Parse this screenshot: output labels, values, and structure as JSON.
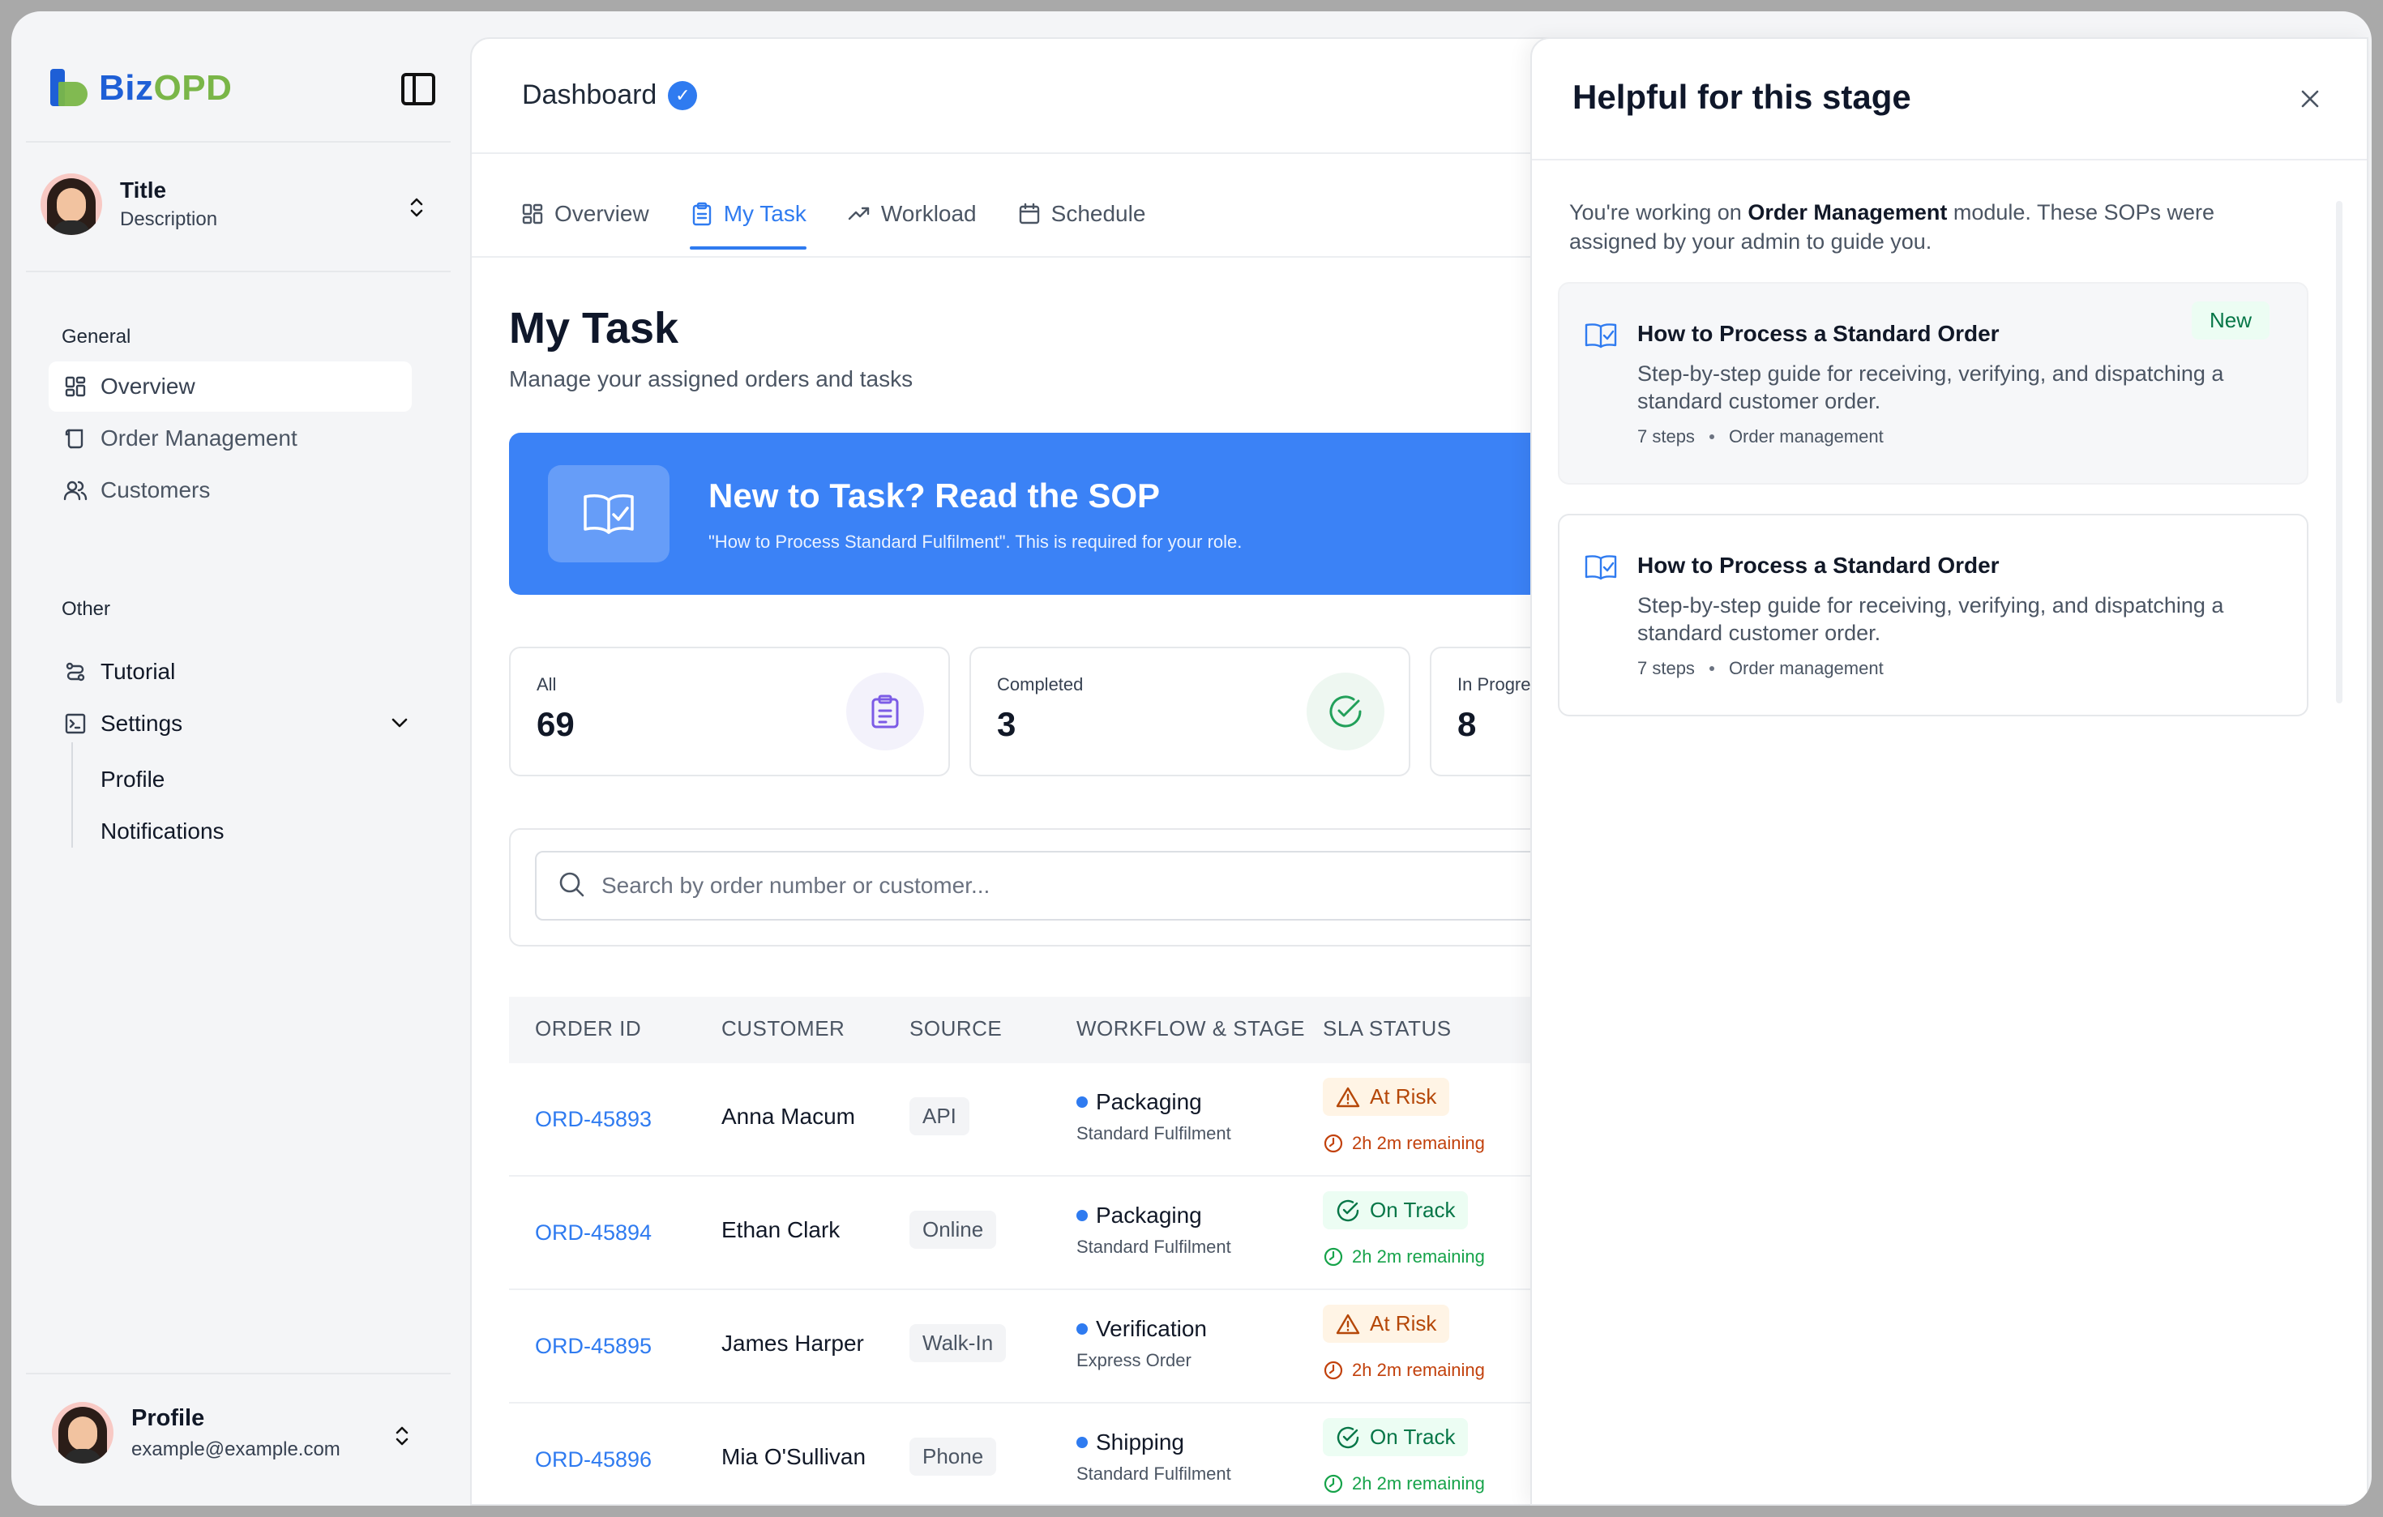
{
  "app": {
    "logo_left": "Biz",
    "logo_right": "OPD"
  },
  "sidebar": {
    "user_top": {
      "title": "Title",
      "description": "Description"
    },
    "general_label": "General",
    "general_items": [
      {
        "label": "Overview",
        "icon": "grid-icon",
        "active": true
      },
      {
        "label": "Order Management",
        "icon": "scroll-icon"
      },
      {
        "label": "Customers",
        "icon": "users-icon"
      }
    ],
    "other_label": "Other",
    "other_items": [
      {
        "label": "Tutorial",
        "icon": "route-icon"
      },
      {
        "label": "Settings",
        "icon": "terminal-icon"
      }
    ],
    "settings_sub": [
      "Profile",
      "Notifications"
    ],
    "user_bottom": {
      "name": "Profile",
      "email": "example@example.com"
    }
  },
  "header": {
    "title": "Dashboard"
  },
  "tabs": [
    {
      "label": "Overview",
      "icon": "grid-icon"
    },
    {
      "label": "My Task",
      "icon": "clipboard-icon",
      "active": true
    },
    {
      "label": "Workload",
      "icon": "trend-icon"
    },
    {
      "label": "Schedule",
      "icon": "calendar-icon"
    }
  ],
  "page": {
    "title": "My Task",
    "subtitle": "Manage your assigned orders and tasks"
  },
  "banner": {
    "heading": "New to Task? Read the SOP",
    "text": "\"How to Process Standard Fulfilment\". This is required for your role."
  },
  "stats": [
    {
      "label": "All",
      "value": "69",
      "icon": "clipboard-icon"
    },
    {
      "label": "Completed",
      "value": "3",
      "icon": "check-circle-icon"
    },
    {
      "label": "In Progre",
      "value": "8"
    }
  ],
  "search": {
    "placeholder": "Search by order number or customer..."
  },
  "table": {
    "columns": [
      "ORDER ID",
      "CUSTOMER",
      "SOURCE",
      "WORKFLOW & STAGE",
      "SLA STATUS"
    ],
    "rows": [
      {
        "order_id": "ORD-45893",
        "customer": "Anna Macum",
        "source": "API",
        "stage": "Packaging",
        "workflow": "Standard Fulfilment",
        "sla": "At Risk",
        "sla_kind": "risk",
        "remaining": "2h 2m remaining"
      },
      {
        "order_id": "ORD-45894",
        "customer": "Ethan Clark",
        "source": "Online",
        "stage": "Packaging",
        "workflow": "Standard Fulfilment",
        "sla": "On Track",
        "sla_kind": "ok",
        "remaining": "2h 2m remaining"
      },
      {
        "order_id": "ORD-45895",
        "customer": "James Harper",
        "source": "Walk-In",
        "stage": "Verification",
        "workflow": "Express Order",
        "sla": "At Risk",
        "sla_kind": "risk",
        "remaining": "2h 2m remaining"
      },
      {
        "order_id": "ORD-45896",
        "customer": "Mia O'Sullivan",
        "source": "Phone",
        "stage": "Shipping",
        "workflow": "Standard Fulfilment",
        "sla": "On Track",
        "sla_kind": "ok",
        "remaining": "2h 2m remaining"
      }
    ]
  },
  "panel": {
    "title": "Helpful for this stage",
    "intro_prefix": "You're working on ",
    "intro_module": "Order Management",
    "intro_suffix": " module. These SOPs were assigned by your admin to guide you.",
    "cards": [
      {
        "title": "How to Process a Standard Order",
        "description": "Step-by-step guide for receiving, verifying, and dispatching a standard customer order.",
        "steps": "7 steps",
        "category": "Order management",
        "badge": "New"
      },
      {
        "title": "How to Process a Standard Order",
        "description": "Step-by-step guide for receiving, verifying, and dispatching a standard customer order.",
        "steps": "7 steps",
        "category": "Order management"
      }
    ]
  },
  "colors": {
    "accent": "#2f7bf0",
    "banner": "#3b82f6",
    "risk_bg": "#fff4e5",
    "risk_text": "#b54708",
    "ok_bg": "#ecfdf3",
    "ok_text": "#067647"
  }
}
